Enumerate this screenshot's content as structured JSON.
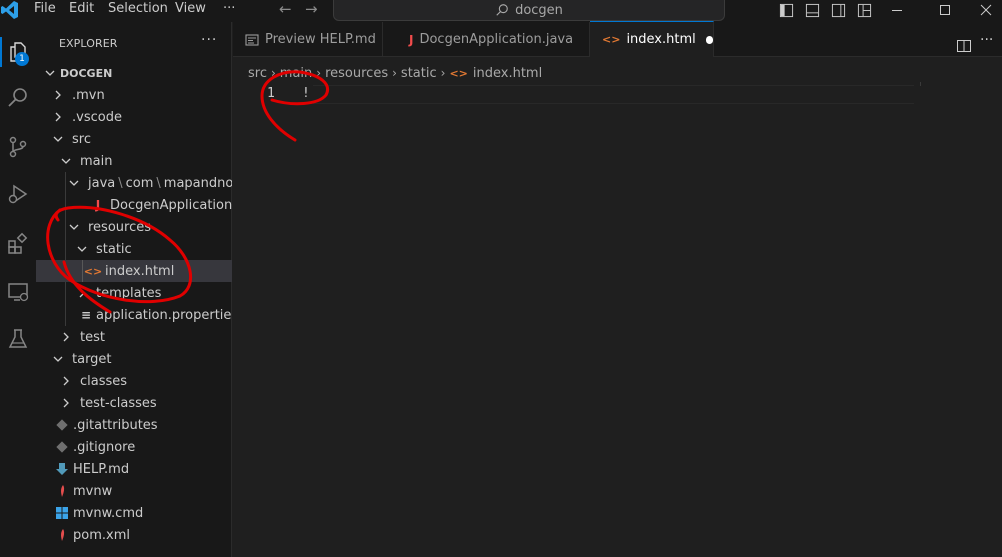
{
  "menu": {
    "file": "File",
    "edit": "Edit",
    "selection": "Selection",
    "view": "View",
    "more": "···"
  },
  "search": {
    "text": "docgen"
  },
  "activity": {
    "explorer_badge": "1"
  },
  "explorer": {
    "title": "EXPLORER",
    "more": "···",
    "root": "DOCGEN",
    "items": [
      {
        "label": ".mvn"
      },
      {
        "label": ".vscode"
      },
      {
        "label": "src"
      },
      {
        "label": "main"
      },
      {
        "label": "java",
        "path_sep": "\\",
        "path2": "com",
        "path3": "mapandnot..."
      },
      {
        "label": "DocgenApplication.ja...",
        "icon": "J"
      },
      {
        "label": "resources"
      },
      {
        "label": "static"
      },
      {
        "label": "index.html",
        "icon": "<>"
      },
      {
        "label": "templates"
      },
      {
        "label": "application.properties",
        "icon": "≡"
      },
      {
        "label": "test"
      },
      {
        "label": "target"
      },
      {
        "label": "classes"
      },
      {
        "label": "test-classes"
      },
      {
        "label": ".gitattributes"
      },
      {
        "label": ".gitignore"
      },
      {
        "label": "HELP.md"
      },
      {
        "label": "mvnw"
      },
      {
        "label": "mvnw.cmd"
      },
      {
        "label": "pom.xml"
      }
    ]
  },
  "tabs": [
    {
      "label": "Preview HELP.md"
    },
    {
      "label": "DocgenApplication.java",
      "icon": "J"
    },
    {
      "label": "index.html",
      "icon": "<>"
    }
  ],
  "breadcrumb": [
    "src",
    "main",
    "resources",
    "static",
    "index.html"
  ],
  "editor": {
    "line_number": "1",
    "code": "!"
  },
  "colors": {
    "accent": "#0078d4",
    "html_icon": "#e37933",
    "java_icon": "#f14c4c",
    "annotation": "#e00000"
  }
}
